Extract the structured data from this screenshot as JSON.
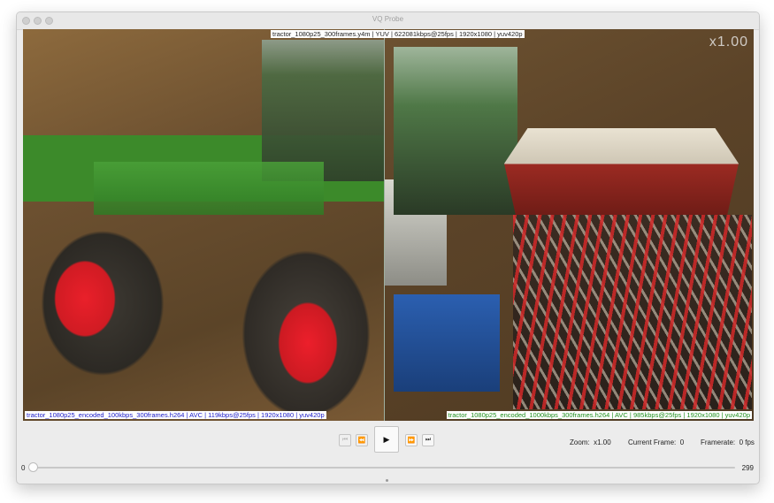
{
  "window": {
    "title": "VQ Probe"
  },
  "video": {
    "top_label": "tractor_1080p25_300frames.y4m | YUV | 622081kbps@25fps | 1920x1080 | yuv420p",
    "left_label": "tractor_1080p25_encoded_100kbps_300frames.h264 | AVC | 119kbps@25fps | 1920x1080 | yuv420p",
    "right_label": "tractor_1080p25_encoded_1000kbps_300frames.h264 | AVC | 985kbps@25fps | 1920x1080 | yuv420p",
    "zoom_overlay": "x1.00"
  },
  "controls": {
    "first_frame_icon": "⏮",
    "prev_frame_icon": "⏪",
    "play_icon": "▶",
    "next_frame_icon": "⏩",
    "last_frame_icon": "⏭",
    "zoom_label": "Zoom:",
    "zoom_value": "x1.00",
    "current_frame_label": "Current Frame:",
    "current_frame_value": "0",
    "framerate_label": "Framerate:",
    "framerate_value": "0 fps"
  },
  "slider": {
    "min": "0",
    "max": "299",
    "position_fraction": 0.0
  }
}
